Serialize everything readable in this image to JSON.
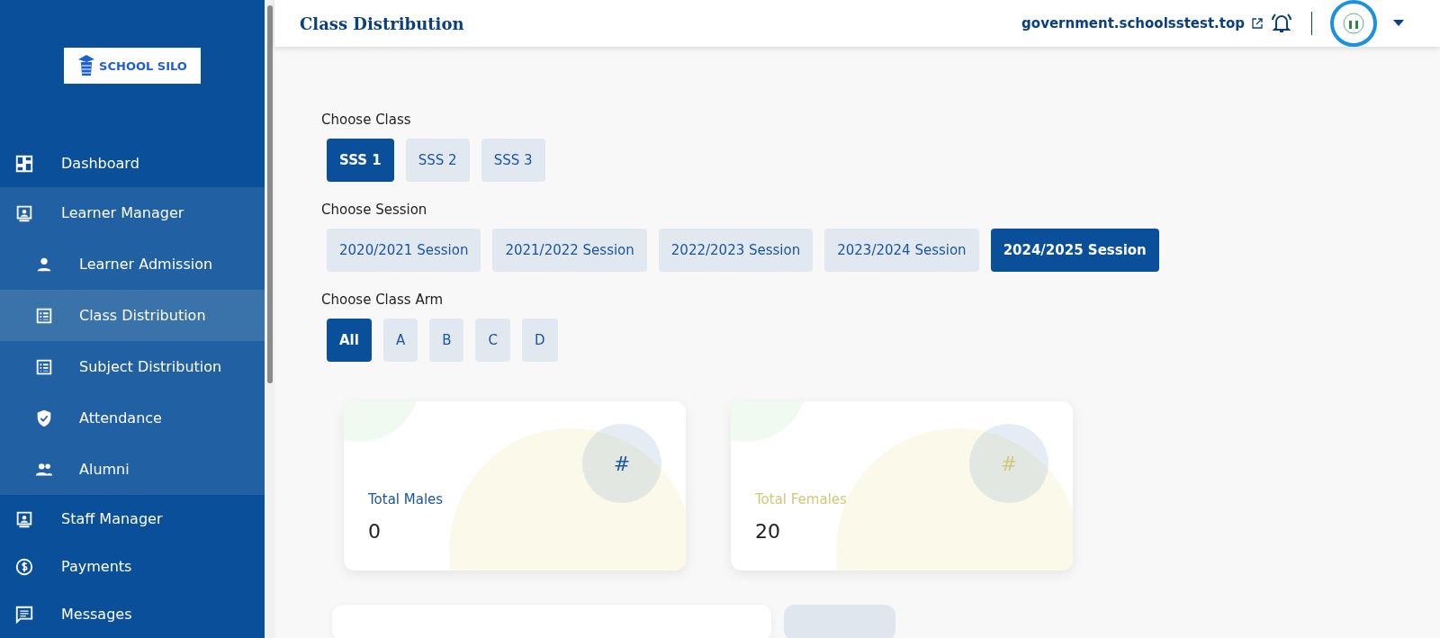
{
  "sidebar": {
    "logo": "SCHOOL SILO",
    "items": [
      {
        "label": "Dashboard",
        "selected": false
      },
      {
        "label": "Learner Manager",
        "selected": false,
        "expanded": true,
        "children": [
          {
            "label": "Learner Admission",
            "selected": false
          },
          {
            "label": "Class Distribution",
            "selected": true
          },
          {
            "label": "Subject Distribution",
            "selected": false
          },
          {
            "label": "Attendance",
            "selected": false
          },
          {
            "label": "Alumni",
            "selected": false
          }
        ]
      },
      {
        "label": "Staff Manager",
        "selected": false
      },
      {
        "label": "Payments",
        "selected": false
      },
      {
        "label": "Messages",
        "selected": false
      }
    ]
  },
  "header": {
    "title": "Class Distribution",
    "domain": "government.schoolsstest.top"
  },
  "filters": [
    {
      "label": "Choose Class",
      "options": [
        {
          "label": "SSS 1",
          "selected": true
        },
        {
          "label": "SSS 2",
          "selected": false
        },
        {
          "label": "SSS 3",
          "selected": false
        }
      ]
    },
    {
      "label": "Choose Session",
      "options": [
        {
          "label": "2020/2021 Session",
          "selected": false
        },
        {
          "label": "2021/2022 Session",
          "selected": false
        },
        {
          "label": "2022/2023 Session",
          "selected": false
        },
        {
          "label": "2023/2024 Session",
          "selected": false
        },
        {
          "label": "2024/2025 Session",
          "selected": true
        }
      ]
    },
    {
      "label": "Choose Class Arm",
      "options": [
        {
          "label": "All",
          "selected": true
        },
        {
          "label": "A",
          "selected": false
        },
        {
          "label": "B",
          "selected": false
        },
        {
          "label": "C",
          "selected": false
        },
        {
          "label": "D",
          "selected": false
        }
      ]
    }
  ],
  "stats": [
    {
      "symbol": "#",
      "label": "Total Males",
      "value": "0",
      "color": "#1a56a0"
    },
    {
      "symbol": "#",
      "label": "Total Females",
      "value": "20",
      "color": "#cfc97a"
    }
  ]
}
